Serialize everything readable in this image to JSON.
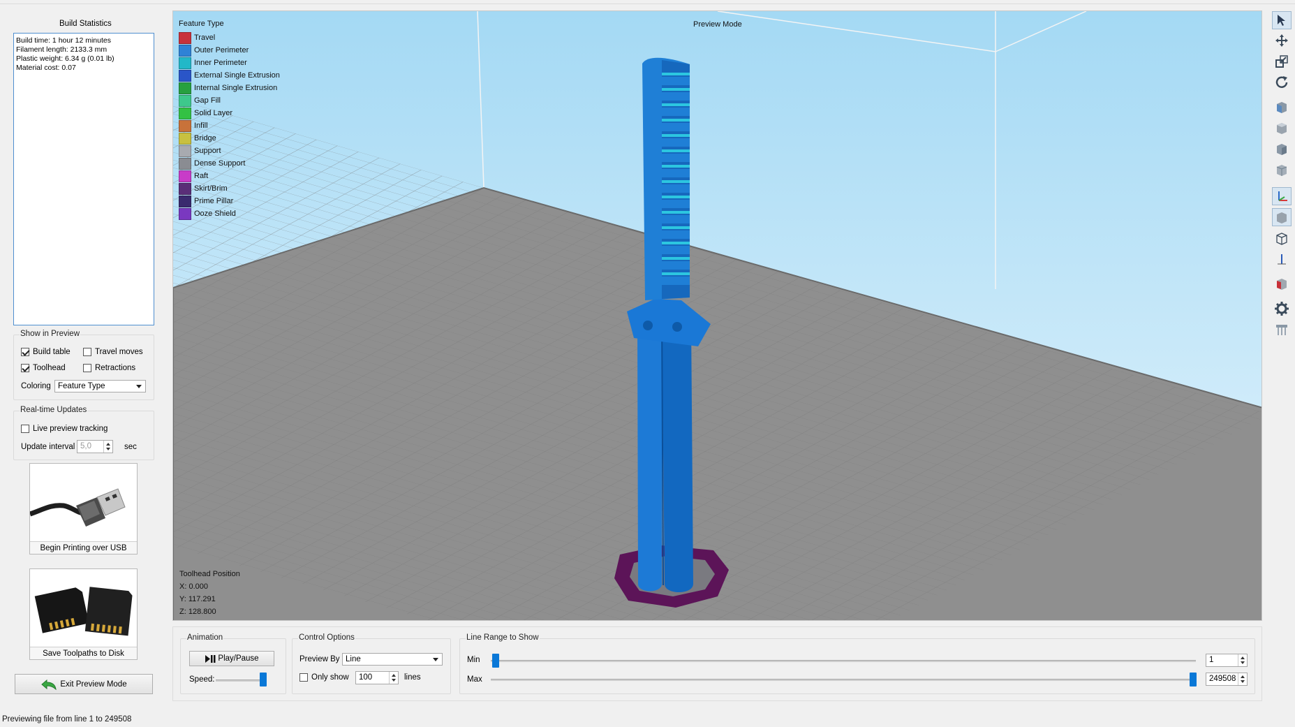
{
  "build_stats": {
    "title": "Build Statistics",
    "lines": [
      "Build time: 1 hour 12 minutes",
      "Filament length: 2133.3 mm",
      "Plastic weight: 6.34 g (0.01 lb)",
      "Material cost: 0.07"
    ]
  },
  "show_in_preview": {
    "title": "Show in Preview",
    "build_table": {
      "label": "Build table",
      "checked": true
    },
    "travel_moves": {
      "label": "Travel moves",
      "checked": false
    },
    "toolhead": {
      "label": "Toolhead",
      "checked": true
    },
    "retractions": {
      "label": "Retractions",
      "checked": false
    },
    "coloring_label": "Coloring",
    "coloring_value": "Feature Type"
  },
  "realtime": {
    "title": "Real-time Updates",
    "live_tracking": {
      "label": "Live preview tracking",
      "checked": false
    },
    "interval_label": "Update interval",
    "interval_value": "5,0",
    "interval_unit": "sec"
  },
  "actions": {
    "usb_label": "Begin Printing over USB",
    "disk_label": "Save Toolpaths to Disk",
    "exit_label": "Exit Preview Mode"
  },
  "viewport": {
    "mode_label": "Preview Mode",
    "legend_title": "Feature Type",
    "legend": [
      {
        "label": "Travel",
        "color": "#c8323c"
      },
      {
        "label": "Outer Perimeter",
        "color": "#2f82d6"
      },
      {
        "label": "Inner Perimeter",
        "color": "#22b8c8"
      },
      {
        "label": "External Single Extrusion",
        "color": "#2a55c8"
      },
      {
        "label": "Internal Single Extrusion",
        "color": "#27a040"
      },
      {
        "label": "Gap Fill",
        "color": "#3ec88c"
      },
      {
        "label": "Solid Layer",
        "color": "#33c144"
      },
      {
        "label": "Infill",
        "color": "#c8723a"
      },
      {
        "label": "Bridge",
        "color": "#c8c040"
      },
      {
        "label": "Support",
        "color": "#a8aab0"
      },
      {
        "label": "Dense Support",
        "color": "#8a8c92"
      },
      {
        "label": "Raft",
        "color": "#c83cc8"
      },
      {
        "label": "Skirt/Brim",
        "color": "#5a2e78"
      },
      {
        "label": "Prime Pillar",
        "color": "#3a2a6e"
      },
      {
        "label": "Ooze Shield",
        "color": "#7a38c0"
      }
    ],
    "toolhead_title": "Toolhead Position",
    "toolhead_x": "X: 0.000",
    "toolhead_y": "Y: 117.291",
    "toolhead_z": "Z: 128.800"
  },
  "animation": {
    "title": "Animation",
    "play_label": "Play/Pause",
    "speed_label": "Speed:"
  },
  "control": {
    "title": "Control Options",
    "preview_by_label": "Preview By",
    "preview_by_value": "Line",
    "only_show_label": "Only show",
    "only_show_value": "100",
    "lines_label": "lines"
  },
  "line_range": {
    "title": "Line Range to Show",
    "min_label": "Min",
    "max_label": "Max",
    "min_value": "1",
    "max_value": "249508"
  },
  "status": "Previewing file from line 1 to 249508",
  "toolbar": [
    "select-icon",
    "move-icon",
    "scale-icon",
    "rotate-icon",
    "view-front-icon",
    "view-top-icon",
    "view-left-icon",
    "view-iso-icon",
    "axes-icon",
    "solid-view-icon",
    "wireframe-icon",
    "z-axis-icon",
    "section-icon",
    "settings-gear-icon",
    "support-icon"
  ],
  "colors": {
    "accent": "#0a78d7",
    "part": "#1f7fd6",
    "bed": "#8e8e8e",
    "sky": "#a8dcf6",
    "raft": "#6e1a66"
  }
}
